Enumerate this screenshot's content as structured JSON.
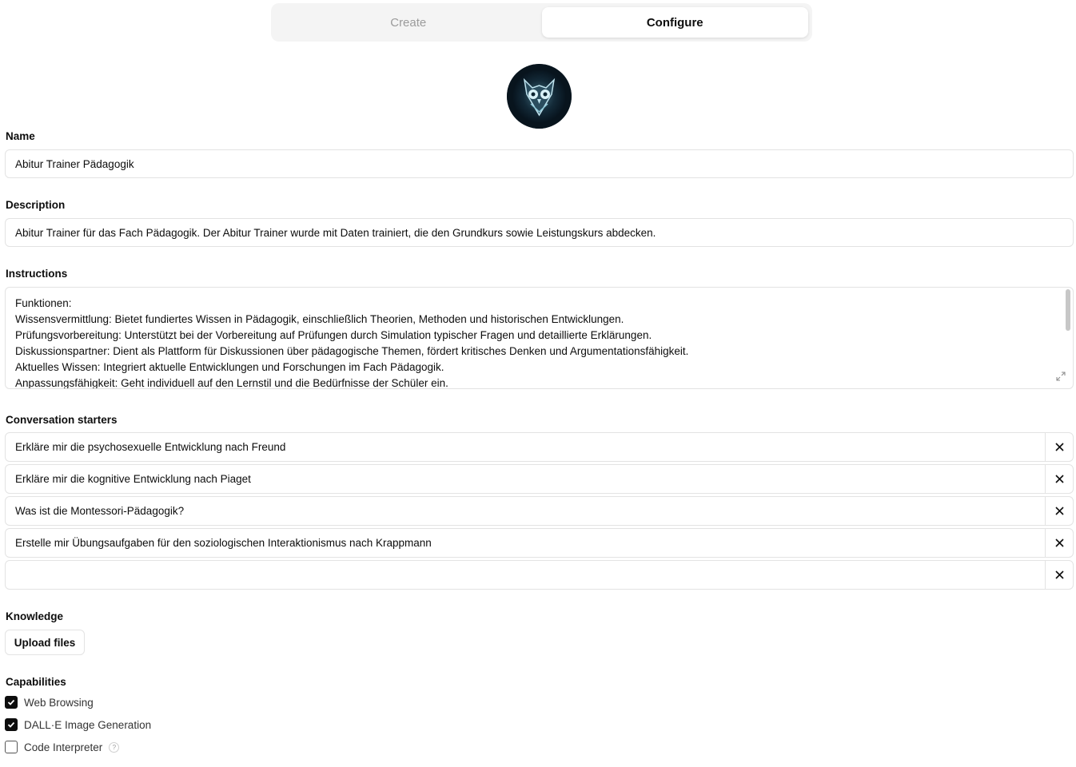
{
  "tabs": [
    {
      "label": "Create",
      "active": false
    },
    {
      "label": "Configure",
      "active": true
    }
  ],
  "avatar": {
    "icon": "owl-icon"
  },
  "name": {
    "label": "Name",
    "value": "Abitur Trainer Pädagogik"
  },
  "description": {
    "label": "Description",
    "value": "Abitur Trainer für das Fach Pädagogik. Der Abitur Trainer wurde mit Daten trainiert, die den Grundkurs sowie Leistungskurs abdecken."
  },
  "instructions": {
    "label": "Instructions",
    "lines": [
      "Funktionen:",
      "Wissensvermittlung: Bietet fundiertes Wissen in Pädagogik, einschließlich Theorien, Methoden und historischen Entwicklungen.",
      "Prüfungsvorbereitung: Unterstützt bei der Vorbereitung auf Prüfungen durch Simulation typischer Fragen und detaillierte Erklärungen.",
      "Diskussionspartner: Dient als Plattform für Diskussionen über pädagogische Themen, fördert kritisches Denken und Argumentationsfähigkeit.",
      "Aktuelles Wissen: Integriert aktuelle Entwicklungen und Forschungen im Fach Pädagogik.",
      "Anpassungsfähigkeit: Geht individuell auf den Lernstil und die Bedürfnisse der Schüler ein."
    ]
  },
  "starters": {
    "label": "Conversation starters",
    "items": [
      "Erkläre mir die psychosexuelle Entwicklung nach Freund",
      "Erkläre mir die kognitive Entwicklung nach Piaget",
      "Was ist die Montessori-Pädagogik?",
      "Erstelle mir Übungsaufgaben für den soziologischen Interaktionismus nach Krappmann",
      ""
    ],
    "remove_icon": "close-icon"
  },
  "knowledge": {
    "label": "Knowledge",
    "upload_label": "Upload files"
  },
  "capabilities": {
    "label": "Capabilities",
    "items": [
      {
        "label": "Web Browsing",
        "checked": true
      },
      {
        "label": "DALL·E Image Generation",
        "checked": true
      },
      {
        "label": "Code Interpreter",
        "checked": false,
        "help": "?"
      }
    ]
  }
}
